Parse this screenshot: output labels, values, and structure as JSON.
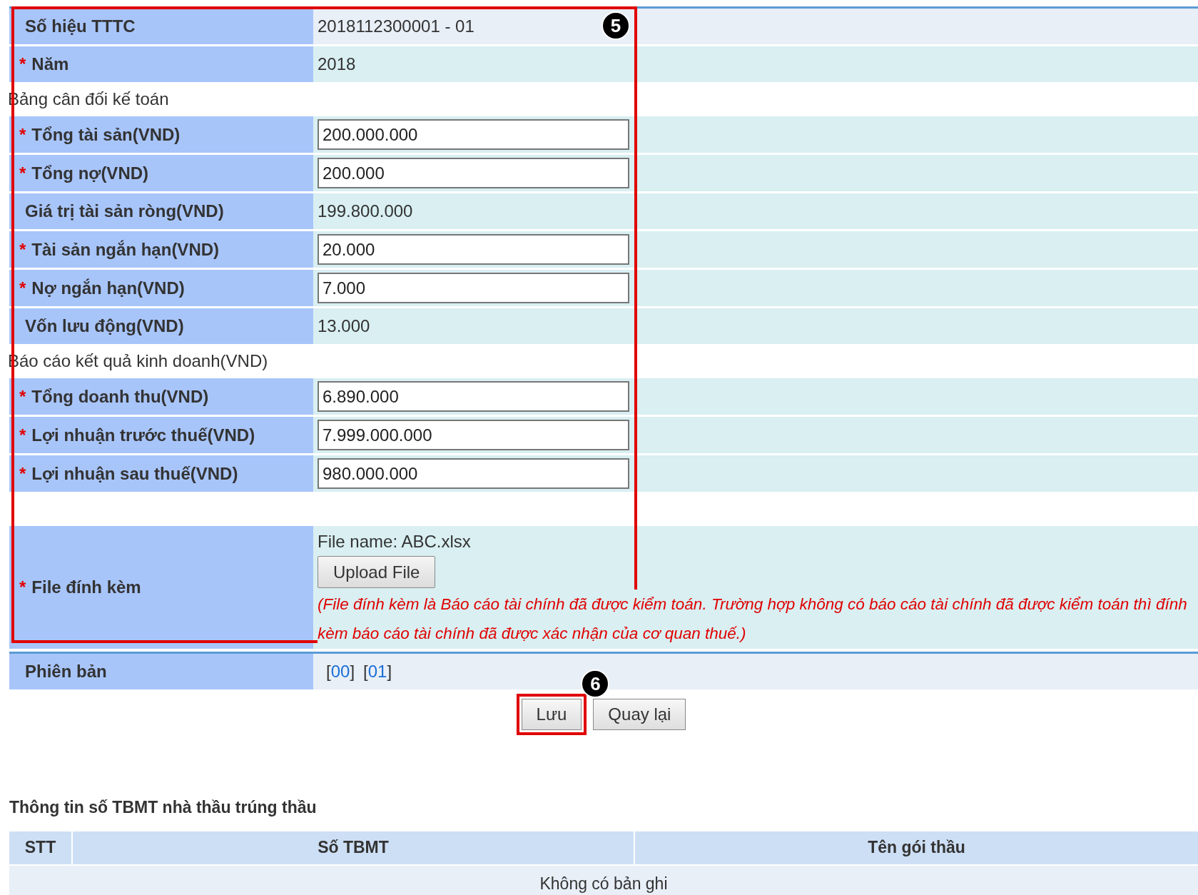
{
  "form": {
    "rows": [
      {
        "kind": "text",
        "label": "Số hiệu TTTC",
        "value": "2018112300001 - 01",
        "color": "#e8eff7"
      },
      {
        "kind": "text",
        "marker": "*",
        "label": "Năm",
        "value": "2018",
        "color": "#d9eff2"
      },
      {
        "kind": "section",
        "text": "Bảng cân đối kế toán"
      },
      {
        "kind": "input",
        "marker": "*",
        "label": "Tổng tài sản(VND)",
        "value": "200.000.000"
      },
      {
        "kind": "input",
        "marker": "*",
        "label": "Tổng nợ(VND)",
        "value": "200.000"
      },
      {
        "kind": "text",
        "label": "Giá trị tài sản ròng(VND)",
        "value": "199.800.000",
        "color": "#d9eff2"
      },
      {
        "kind": "input",
        "marker": "*",
        "label": "Tài sản ngắn hạn(VND)",
        "value": "20.000"
      },
      {
        "kind": "input",
        "marker": "*",
        "label": "Nợ ngắn hạn(VND)",
        "value": "7.000"
      },
      {
        "kind": "text",
        "label": "Vốn lưu động(VND)",
        "value": "13.000",
        "color": "#d9eff2"
      },
      {
        "kind": "section",
        "text": "Báo cáo kết quả kinh doanh(VND)"
      },
      {
        "kind": "input",
        "marker": "*",
        "label": "Tổng doanh thu(VND)",
        "value": "6.890.000"
      },
      {
        "kind": "input",
        "marker": "*",
        "label": "Lợi nhuận trước thuế(VND)",
        "value": "7.999.000.000"
      },
      {
        "kind": "input",
        "marker": "*",
        "label": "Lợi nhuận sau thuế(VND)",
        "value": "980.000.000"
      },
      {
        "kind": "spacer"
      },
      {
        "kind": "file",
        "marker": "*",
        "label": "File đính kèm",
        "file_name": "File name: ABC.xlsx",
        "button": "Upload File",
        "note": "(File đính kèm là Báo cáo tài chính đã được kiểm toán. Trường hợp không có báo cáo tài chính đã được kiểm toán thì đính kèm báo cáo tài chính đã được xác nhận của cơ quan thuế.)"
      }
    ],
    "callout": "5"
  },
  "versions": {
    "label": "Phiên bản",
    "items": [
      {
        "before": "[",
        "link": "00",
        "after": "]"
      },
      {
        "before": "[",
        "link": "01",
        "after": "]"
      }
    ]
  },
  "buttons": [
    {
      "label": "Lưu",
      "highlighted": true,
      "callout": "6"
    },
    {
      "label": "Quay lại",
      "highlighted": false
    }
  ],
  "winners": {
    "heading": "Thông tin số TBMT nhà thầu trúng thầu",
    "columns": [
      "STT",
      "Số TBMT",
      "Tên gói thầu"
    ],
    "empty": "Không có bản ghi"
  }
}
